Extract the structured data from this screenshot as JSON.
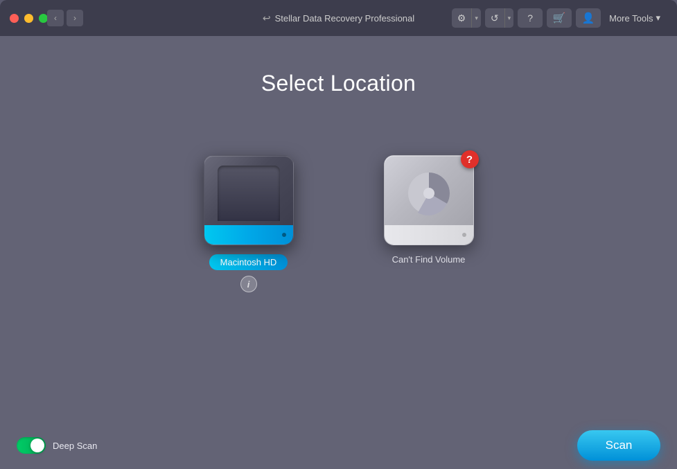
{
  "window": {
    "title": "Stellar Data Recovery Professional",
    "traffic": {
      "close": "close",
      "minimize": "minimize",
      "maximize": "maximize"
    }
  },
  "titlebar": {
    "nav_back": "‹",
    "nav_forward": "›",
    "title": "Stellar Data Recovery Professional",
    "tools": {
      "settings_label": "⚙",
      "history_label": "↺",
      "help_label": "?",
      "cart_label": "🛒",
      "account_label": "👤",
      "arrow": "▾"
    },
    "more_tools": "More Tools",
    "more_tools_arrow": "▾"
  },
  "main": {
    "page_title": "Select Location",
    "drives": [
      {
        "id": "macintosh-hd",
        "label": "Macintosh HD",
        "selected": true,
        "type": "mac"
      },
      {
        "id": "cant-find-volume",
        "label": "Can't Find Volume",
        "selected": false,
        "type": "cantfind"
      }
    ]
  },
  "bottom": {
    "deep_scan_label": "Deep Scan",
    "scan_button_label": "Scan",
    "toggle_on": true
  },
  "icons": {
    "info": "i",
    "question": "?",
    "settings": "⚙",
    "history": "↺",
    "help": "?",
    "cart": "⊞",
    "account": "⊙",
    "arrow_down": "▾",
    "chevron_left": "‹",
    "chevron_right": "›"
  }
}
